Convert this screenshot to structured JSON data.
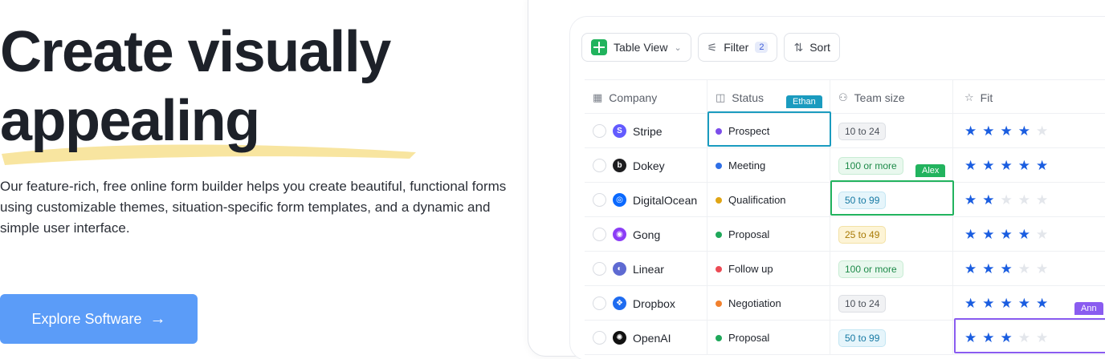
{
  "hero": {
    "title_line1": "Create visually",
    "title_line2": "appealing",
    "description": "Our feature-rich, free online form builder helps you create beautiful, functional forms using customizable themes, situation-specific form templates, and a dynamic and simple user interface.",
    "cta_label": "Explore Software",
    "cta_arrow": "→"
  },
  "toolbar": {
    "view_label": "Table View",
    "filter_label": "Filter",
    "filter_count": "2",
    "sort_label": "Sort"
  },
  "columns": {
    "company": "Company",
    "status": "Status",
    "team_size": "Team size",
    "fit": "Fit"
  },
  "rows": [
    {
      "company": "Stripe",
      "status": "Prospect",
      "team_size": "10 to 24",
      "fit": 4
    },
    {
      "company": "Dokey",
      "status": "Meeting",
      "team_size": "100 or more",
      "fit": 5
    },
    {
      "company": "DigitalOcean",
      "status": "Qualification",
      "team_size": "50 to 99",
      "fit": 2
    },
    {
      "company": "Gong",
      "status": "Proposal",
      "team_size": "25 to 49",
      "fit": 4
    },
    {
      "company": "Linear",
      "status": "Follow up",
      "team_size": "100 or more",
      "fit": 3
    },
    {
      "company": "Dropbox",
      "status": "Negotiation",
      "team_size": "10 to 24",
      "fit": 5
    },
    {
      "company": "OpenAI",
      "status": "Proposal",
      "team_size": "50 to 99",
      "fit": 3
    }
  ],
  "collaborators": {
    "ethan": "Ethan",
    "alex": "Alex",
    "third": "Ann"
  },
  "colors": {
    "cta": "#5b9cf8",
    "star_on": "#1a5de0",
    "star_off": "#e3e6eb",
    "ethan": "#1a9bbf",
    "alex": "#22b35e",
    "third": "#8a5cf0"
  }
}
